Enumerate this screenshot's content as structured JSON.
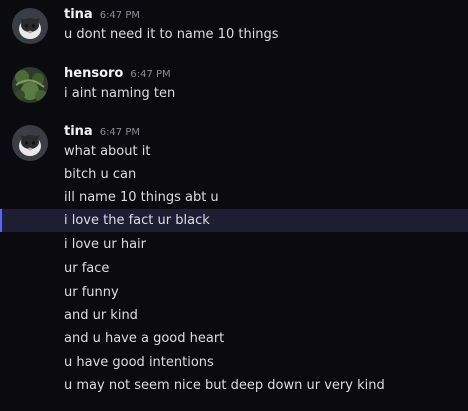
{
  "messages": [
    {
      "username": "tina",
      "timestamp": "6:47 PM",
      "avatar": "cat-avatar",
      "lines": [
        "u dont need it to name 10 things"
      ]
    },
    {
      "username": "hensoro",
      "timestamp": "6:47 PM",
      "avatar": "green-pattern-avatar",
      "lines": [
        "i aint naming ten"
      ]
    },
    {
      "username": "tina",
      "timestamp": "6:47 PM",
      "avatar": "cat-avatar",
      "lines": [
        "what about it",
        "bitch u can",
        "ill name 10 things abt u",
        "i love the fact ur black",
        "i love ur hair",
        "ur face",
        "ur funny",
        "and ur kind",
        "and u have a good heart",
        "u have good intentions",
        "u may not seem nice but deep down ur very kind"
      ]
    }
  ],
  "highlighted_line": "i love the fact ur black",
  "colors": {
    "background": "#0b0b0f",
    "username": "#f2f3f5",
    "timestamp": "#8b8d93",
    "message_text": "#dcdde1",
    "highlight_bg": "#1d1e33",
    "highlight_bar": "#5865f2"
  }
}
